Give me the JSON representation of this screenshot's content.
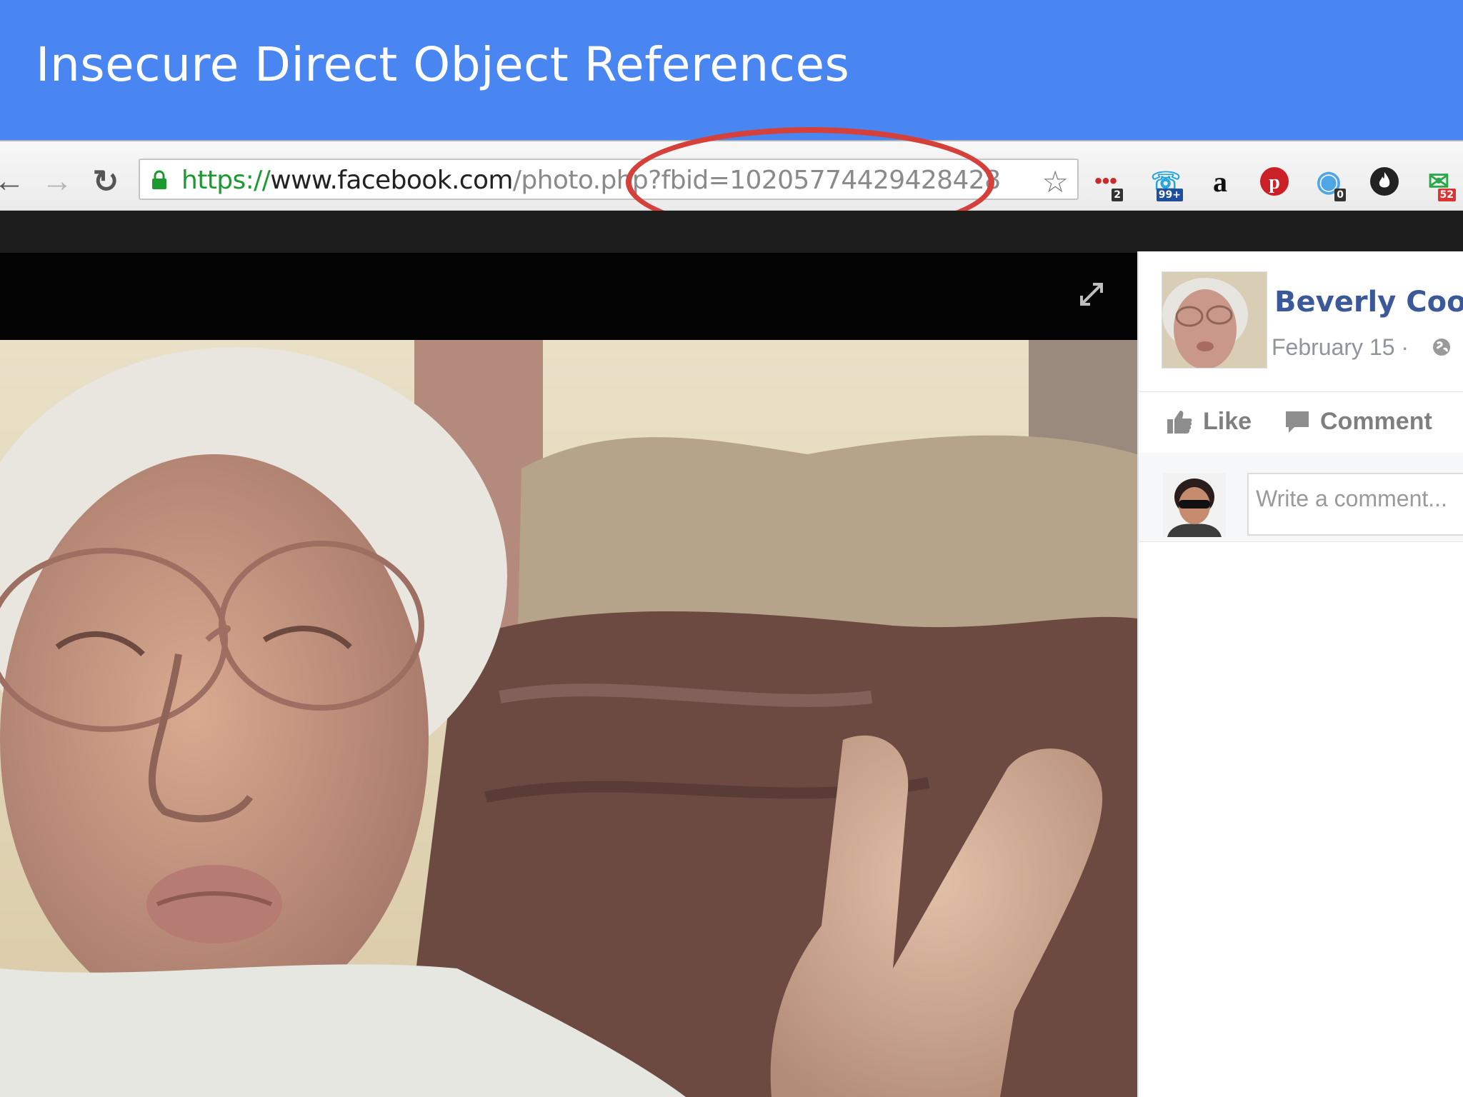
{
  "slide": {
    "title": "Insecure Direct Object References"
  },
  "browser": {
    "url_scheme": "https://",
    "url_host": "www.facebook.com",
    "url_path": "/photo.php?fbid=10205774429428428",
    "extensions": [
      {
        "name": "lastpass-extension",
        "badge": "2"
      },
      {
        "name": "skype-extension",
        "badge": "99+"
      },
      {
        "name": "amazon-extension",
        "badge": ""
      },
      {
        "name": "pinterest-extension",
        "badge": ""
      },
      {
        "name": "ghostery-extension",
        "badge": "0"
      },
      {
        "name": "flame-extension",
        "badge": ""
      },
      {
        "name": "mail-extension",
        "badge": "52"
      }
    ]
  },
  "post": {
    "author_name": "Beverly Coop",
    "date": "February 15 ·",
    "like_label": "Like",
    "comment_label": "Comment",
    "comment_placeholder": "Write a comment..."
  },
  "colors": {
    "slide_header": "#4a86f1",
    "highlight_ellipse": "#d6403b",
    "facebook_name": "#3b5998",
    "secure_url": "#1b9a2f"
  },
  "icons": [
    "back-arrow-icon",
    "forward-arrow-icon",
    "reload-icon",
    "lock-icon",
    "star-icon",
    "expand-icon",
    "globe-icon",
    "like-thumb-icon",
    "comment-bubble-icon"
  ]
}
